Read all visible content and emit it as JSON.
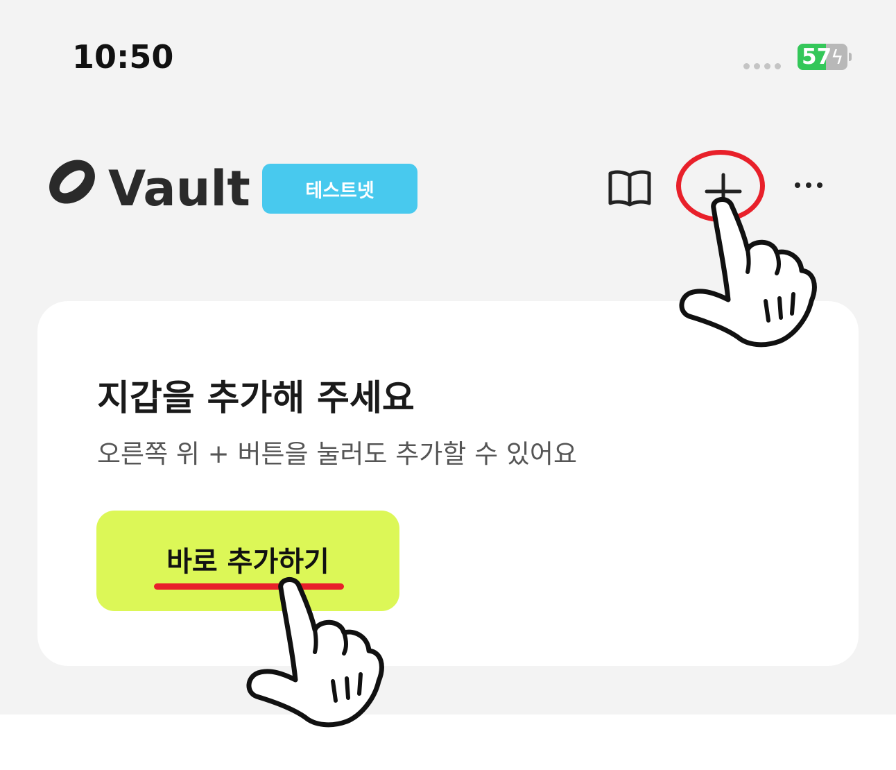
{
  "status_bar": {
    "time": "10:50",
    "battery_level": "57",
    "battery_color": "#34c759"
  },
  "header": {
    "app_name": "Vault",
    "network_badge": "테스트넷",
    "badge_color": "#48c9ee",
    "icons": [
      "logo-icon",
      "book-icon",
      "plus-icon",
      "more-icon"
    ]
  },
  "card": {
    "title": "지갑을 추가해 주세요",
    "subtitle": "오른쪽 위 + 버튼을 눌러도 추가할 수 있어요",
    "button_label": "바로 추가하기",
    "button_color": "#dcf757"
  },
  "annotations": {
    "highlight_color": "#e8202a",
    "pointer_icons": [
      "hand-pointer-icon",
      "hand-pointer-icon"
    ]
  }
}
